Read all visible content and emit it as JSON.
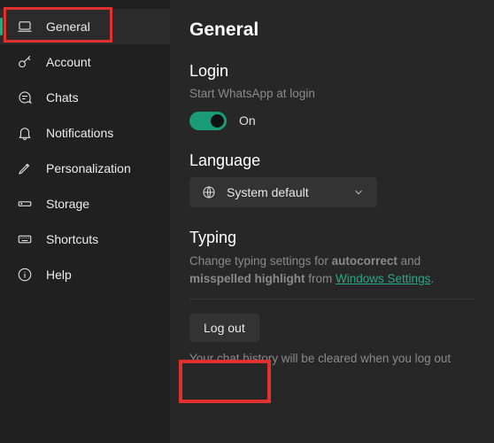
{
  "sidebar": {
    "items": [
      {
        "label": "General",
        "icon": "laptop-icon",
        "selected": true
      },
      {
        "label": "Account",
        "icon": "key-icon"
      },
      {
        "label": "Chats",
        "icon": "chat-icon"
      },
      {
        "label": "Notifications",
        "icon": "bell-icon"
      },
      {
        "label": "Personalization",
        "icon": "pencil-icon"
      },
      {
        "label": "Storage",
        "icon": "storage-icon"
      },
      {
        "label": "Shortcuts",
        "icon": "keyboard-icon"
      },
      {
        "label": "Help",
        "icon": "info-icon"
      }
    ]
  },
  "main": {
    "title": "General",
    "login": {
      "title": "Login",
      "desc": "Start WhatsApp at login",
      "toggle_on": true,
      "toggle_label": "On"
    },
    "language": {
      "title": "Language",
      "selected": "System default"
    },
    "typing": {
      "title": "Typing",
      "desc_pre": "Change typing settings for ",
      "desc_strong1": "autocorrect",
      "desc_mid": " and ",
      "desc_strong2": "misspelled highlight",
      "desc_from": " from ",
      "desc_link": "Windows Settings",
      "desc_period": "."
    },
    "logout": {
      "button": "Log out",
      "desc": "Your chat history will be cleared when you log out"
    }
  }
}
